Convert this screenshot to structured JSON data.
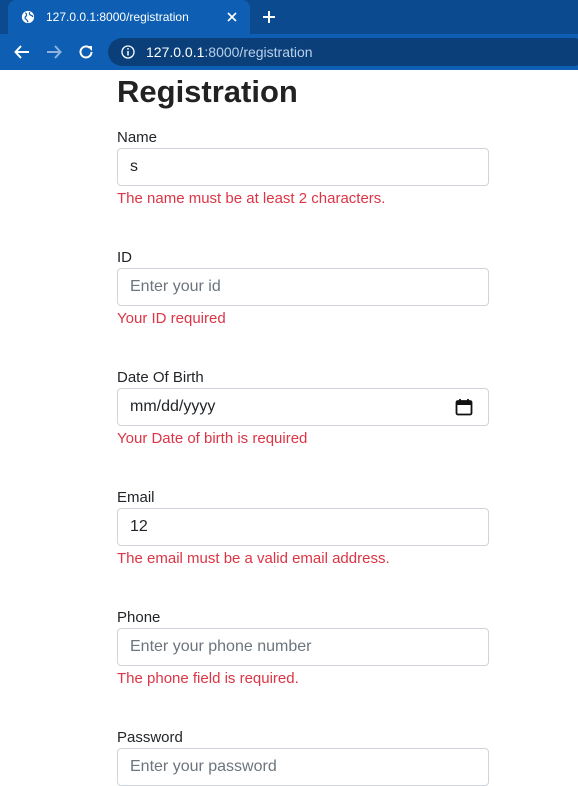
{
  "browser": {
    "tab_title": "127.0.0.1:8000/registration",
    "url_host": "127.0.0.1",
    "url_rest": ":8000/registration"
  },
  "page": {
    "title": "Registration"
  },
  "form": {
    "name": {
      "label": "Name",
      "value": "s",
      "placeholder": "",
      "error": "The name must be at least 2 characters."
    },
    "id": {
      "label": "ID",
      "value": "",
      "placeholder": "Enter your id",
      "error": "Your ID required"
    },
    "dob": {
      "label": "Date Of Birth",
      "display": "mm/dd/yyyy",
      "error": "Your Date of birth is required"
    },
    "email": {
      "label": "Email",
      "value": "12",
      "placeholder": "",
      "error": "The email must be a valid email address."
    },
    "phone": {
      "label": "Phone",
      "value": "",
      "placeholder": "Enter your phone number",
      "error": "The phone field is required."
    },
    "password": {
      "label": "Password",
      "value": "",
      "placeholder": "Enter your password"
    }
  },
  "colors": {
    "chrome_dark": "#0b4a8f",
    "chrome": "#0e5fb3",
    "error": "#dc3545",
    "border": "#ced4da"
  }
}
